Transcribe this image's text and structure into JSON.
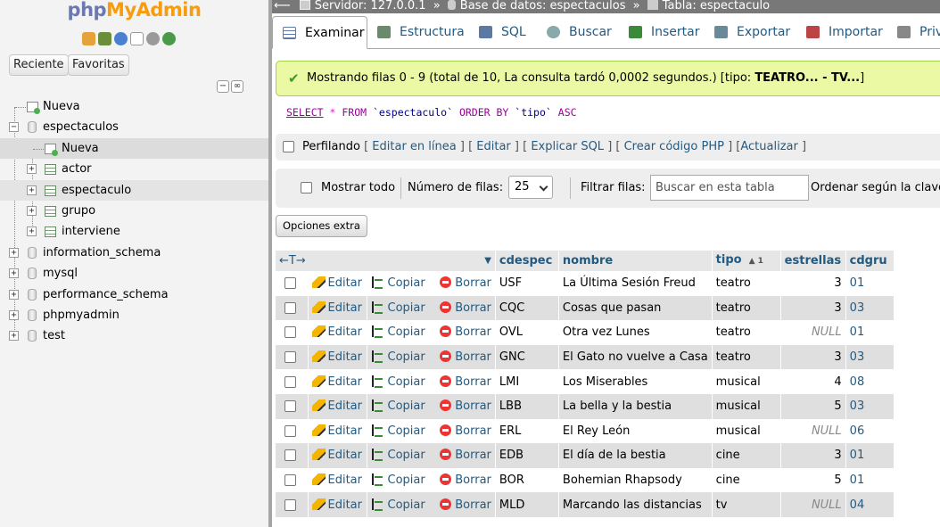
{
  "app": {
    "logo_part1": "php",
    "logo_part2": "MyAdmin"
  },
  "sidebar": {
    "tabs": [
      "Reciente",
      "Favoritas"
    ],
    "tree": [
      {
        "label": "Nueva",
        "level": 0,
        "type": "new"
      },
      {
        "label": "espectaculos",
        "level": 0,
        "type": "db",
        "expanded": true
      },
      {
        "label": "Nueva",
        "level": 1,
        "type": "new",
        "selected": true
      },
      {
        "label": "actor",
        "level": 1,
        "type": "table"
      },
      {
        "label": "espectaculo",
        "level": 1,
        "type": "table",
        "highlighted": true
      },
      {
        "label": "grupo",
        "level": 1,
        "type": "table"
      },
      {
        "label": "interviene",
        "level": 1,
        "type": "table"
      },
      {
        "label": "information_schema",
        "level": 0,
        "type": "db"
      },
      {
        "label": "mysql",
        "level": 0,
        "type": "db"
      },
      {
        "label": "performance_schema",
        "level": 0,
        "type": "db"
      },
      {
        "label": "phpmyadmin",
        "level": 0,
        "type": "db"
      },
      {
        "label": "test",
        "level": 0,
        "type": "db"
      }
    ]
  },
  "breadcrumb": {
    "server": "Servidor: 127.0.0.1",
    "database": "Base de datos: espectaculos",
    "table": "Tabla: espectaculo"
  },
  "tabs": [
    "Examinar",
    "Estructura",
    "SQL",
    "Buscar",
    "Insertar",
    "Exportar",
    "Importar",
    "Privi"
  ],
  "message": {
    "text": "Mostrando filas 0 - 9 (total de 10, La consulta tardó 0,0002 segundos.) [tipo: ",
    "bold": "TEATRO... - TV...",
    "end": "]"
  },
  "query": {
    "select": "SELECT",
    "star": "*",
    "from": "FROM",
    "table": "`espectaculo`",
    "order": "ORDER BY",
    "col": "`tipo`",
    "dir": "ASC"
  },
  "profiling": {
    "label": "Perfilando",
    "links": [
      "Editar en línea",
      "Editar",
      "Explicar SQL",
      "Crear código PHP",
      "Actualizar"
    ]
  },
  "navbar": {
    "show_all": "Mostrar todo",
    "rows_label": "Número de filas:",
    "rows_value": "25",
    "filter_label": "Filtrar filas:",
    "filter_placeholder": "Buscar en esta tabla",
    "sort_label": "Ordenar según la clave:"
  },
  "extra_options": "Opciones extra",
  "table": {
    "columns": [
      "cdespec",
      "nombre",
      "tipo",
      "estrellas",
      "cdgru"
    ],
    "sort_index": "1",
    "actions": {
      "edit": "Editar",
      "copy": "Copiar",
      "delete": "Borrar"
    },
    "rows": [
      [
        "USF",
        "La Última Sesión Freud",
        "teatro",
        "3",
        "01"
      ],
      [
        "CQC",
        "Cosas que pasan",
        "teatro",
        "3",
        "03"
      ],
      [
        "OVL",
        "Otra vez Lunes",
        "teatro",
        "NULL",
        "01"
      ],
      [
        "GNC",
        "El Gato no vuelve a Casa",
        "teatro",
        "3",
        "03"
      ],
      [
        "LMI",
        "Los Miserables",
        "musical",
        "4",
        "08"
      ],
      [
        "LBB",
        "La bella y la bestia",
        "musical",
        "5",
        "03"
      ],
      [
        "ERL",
        "El Rey León",
        "musical",
        "NULL",
        "06"
      ],
      [
        "EDB",
        "El día de la bestia",
        "cine",
        "3",
        "01"
      ],
      [
        "BOR",
        "Bohemian Rhapsody",
        "cine",
        "5",
        "01"
      ],
      [
        "MLD",
        "Marcando las distancias",
        "tv",
        "NULL",
        "04"
      ]
    ]
  }
}
